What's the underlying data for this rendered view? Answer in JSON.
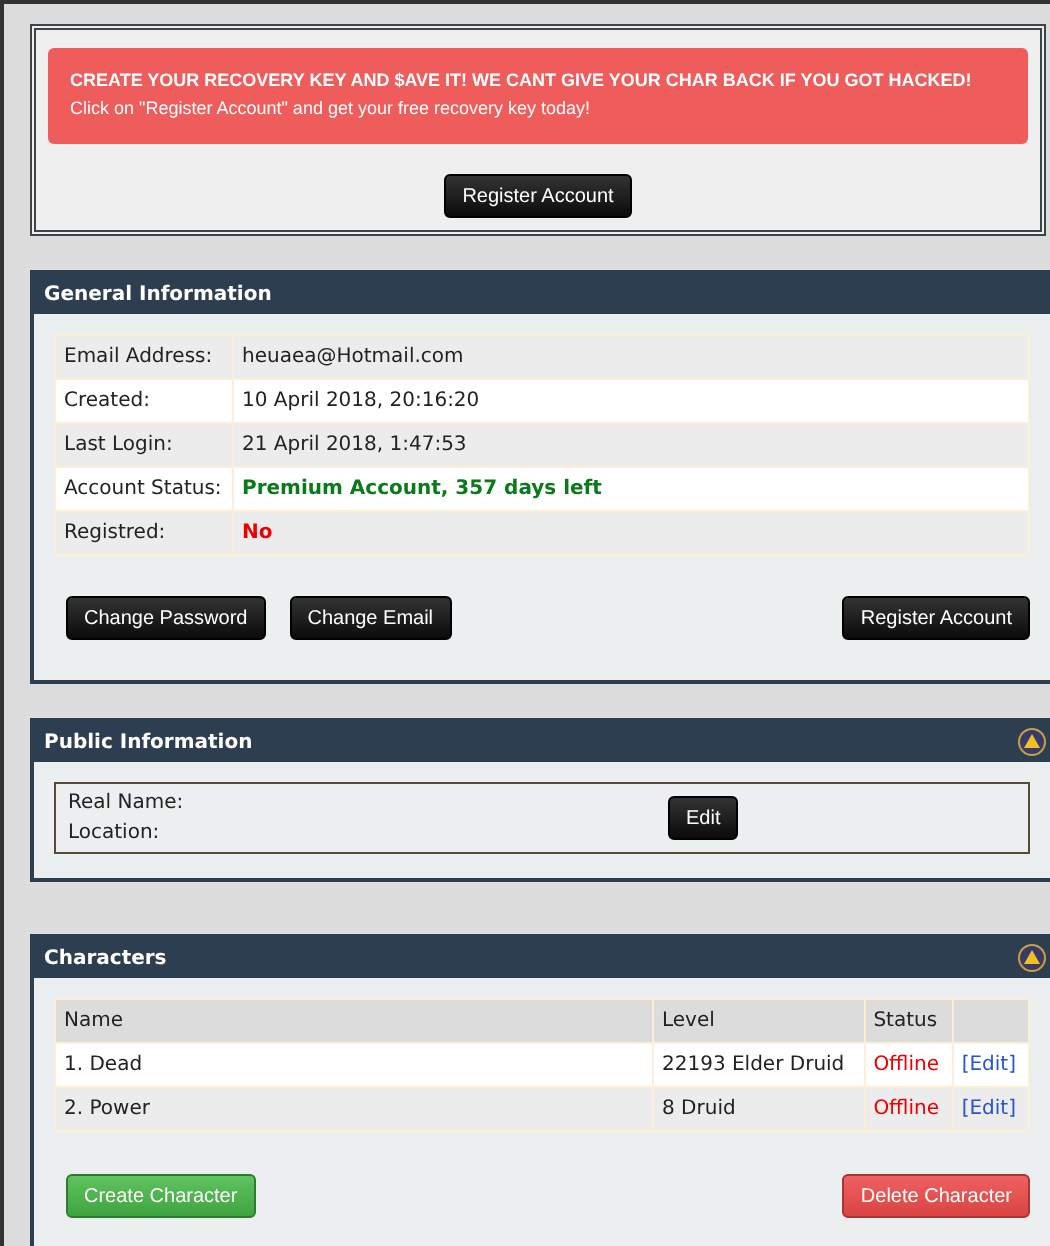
{
  "notice": {
    "title": "CREATE YOUR RECOVERY KEY AND $AVE IT! WE CANT GIVE YOUR CHAR BACK IF YOU GOT HACKED!",
    "text": "Click on \"Register Account\" and get your free recovery key today!",
    "button": "Register Account"
  },
  "general": {
    "title": "General Information",
    "collapsible": false,
    "rows": [
      {
        "label": "Email Address:",
        "value": "heuaea@Hotmail.com",
        "kind": "normal"
      },
      {
        "label": "Created:",
        "value": "10 April 2018, 20:16:20",
        "kind": "normal"
      },
      {
        "label": "Last Login:",
        "value": "21 April 2018, 1:47:53",
        "kind": "normal"
      },
      {
        "label": "Account Status:",
        "value": "Premium Account, 357 days left",
        "kind": "good"
      },
      {
        "label": "Registred:",
        "value": "No",
        "kind": "bad"
      }
    ],
    "buttons_left": [
      "Change Password",
      "Change Email"
    ],
    "button_right": "Register Account"
  },
  "public": {
    "title": "Public Information",
    "collapsible": true,
    "labels": [
      "Real Name:",
      "Location:"
    ],
    "button": "Edit"
  },
  "characters": {
    "title": "Characters",
    "collapsible": true,
    "columns": [
      "Name",
      "Level",
      "Status"
    ],
    "rows": [
      {
        "name": "1. Dead",
        "level": "22193 Elder Druid",
        "status": "Offline",
        "action": "[Edit]"
      },
      {
        "name": "2. Power",
        "level": "8 Druid",
        "status": "Offline",
        "action": "[Edit]"
      }
    ],
    "create_button": "Create Character",
    "delete_button": "Delete Character"
  }
}
